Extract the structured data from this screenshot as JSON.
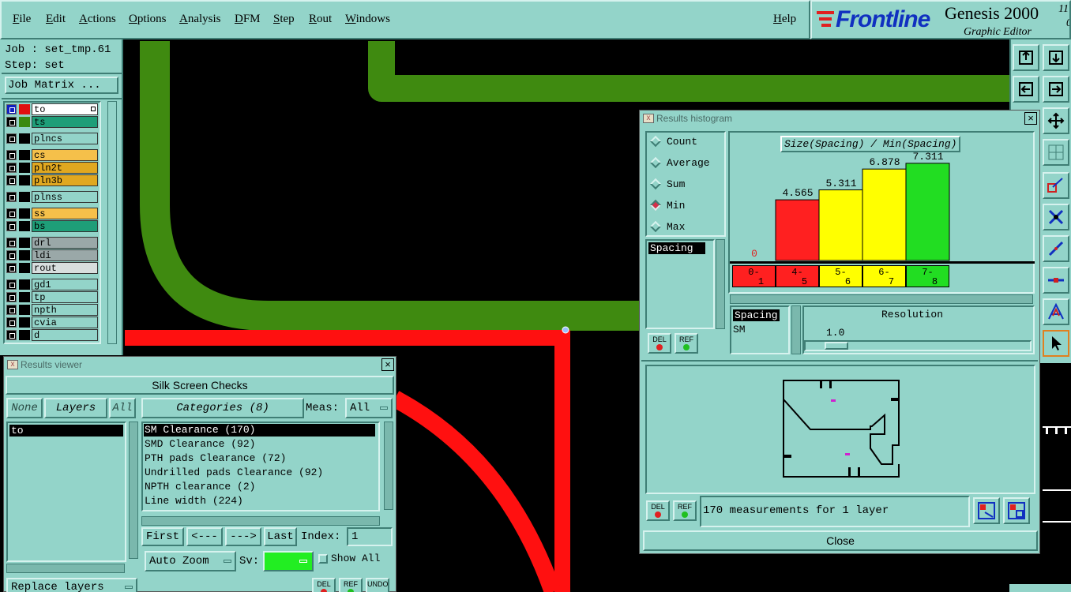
{
  "menubar": {
    "items": [
      "File",
      "Edit",
      "Actions",
      "Options",
      "Analysis",
      "DFM",
      "Step",
      "Rout",
      "Windows"
    ],
    "help": "Help"
  },
  "brand": {
    "logo": "Frontline",
    "product": "Genesis 2000",
    "subtitle": "Graphic Editor",
    "version_partial": "11",
    "extra": "0"
  },
  "job": {
    "job_label": "Job : set_tmp.61",
    "step_label": "Step: set",
    "matrix_button": "Job Matrix ..."
  },
  "layers": [
    {
      "name": "to",
      "color": "#ffffff",
      "swatch": "#e01010",
      "check": "#ffffff"
    },
    {
      "name": "ts",
      "color": "#1e9e78",
      "swatch": "#3a8a10",
      "check": "#000000"
    },
    {
      "name": "plncs",
      "color": "#93d4c9",
      "swatch": "#000000",
      "check": "#000000"
    },
    {
      "name": "cs",
      "color": "#f5c04a",
      "swatch": "#000000",
      "check": "#000000"
    },
    {
      "name": "pln2t",
      "color": "#e0a820",
      "swatch": "#000000",
      "check": "#000000"
    },
    {
      "name": "pln3b",
      "color": "#e0a820",
      "swatch": "#000000",
      "check": "#000000"
    },
    {
      "name": "plnss",
      "color": "#93d4c9",
      "swatch": "#000000",
      "check": "#000000"
    },
    {
      "name": "ss",
      "color": "#f5c04a",
      "swatch": "#000000",
      "check": "#000000"
    },
    {
      "name": "bs",
      "color": "#1e9e78",
      "swatch": "#000000",
      "check": "#000000"
    },
    {
      "name": "drl",
      "color": "#9aa8a8",
      "swatch": "#000000",
      "check": "#000000"
    },
    {
      "name": "ldi",
      "color": "#9aa8a8",
      "swatch": "#000000",
      "check": "#000000"
    },
    {
      "name": "rout",
      "color": "#d8dede",
      "swatch": "#000000",
      "check": "#000000"
    },
    {
      "name": "gd1",
      "color": "#93d4c9",
      "swatch": "#000000",
      "check": "#000000"
    },
    {
      "name": "tp",
      "color": "#93d4c9",
      "swatch": "#000000",
      "check": "#000000"
    },
    {
      "name": "npth",
      "color": "#93d4c9",
      "swatch": "#000000",
      "check": "#000000"
    },
    {
      "name": "cvia",
      "color": "#93d4c9",
      "swatch": "#000000",
      "check": "#000000"
    },
    {
      "name": "d",
      "color": "#93d4c9",
      "swatch": "#000000",
      "check": "#000000"
    }
  ],
  "results_viewer": {
    "title": "Results viewer",
    "section": "Silk Screen Checks",
    "none_btn": "None",
    "layers_btn": "Layers",
    "all_btn": "All",
    "layer_list": [
      "to"
    ],
    "categories_btn": "Categories (8)",
    "meas_label": "Meas:",
    "meas_value": "All",
    "categories": [
      "SM Clearance (170)",
      "SMD Clearance (92)",
      "PTH pads Clearance (72)",
      "Undrilled pads Clearance (92)",
      "NPTH clearance (2)",
      "Line width (224)"
    ],
    "first_btn": "First",
    "prev_btn": "<---",
    "next_btn": "--->",
    "last_btn": "Last",
    "index_label": "Index:",
    "index_value": "1",
    "auto_zoom": "Auto Zoom",
    "sv_label": "Sv:",
    "show_all": "Show All",
    "replace_layers": "Replace layers",
    "del": "DEL",
    "ref": "REF",
    "undo": "UNDO"
  },
  "histogram": {
    "title": "Results histogram",
    "modes": [
      "Count",
      "Average",
      "Sum",
      "Min",
      "Max"
    ],
    "selected_mode": "Min",
    "measure_list": [
      "Spacing"
    ],
    "chart_title": "Size(Spacing) / Min(Spacing)",
    "resolution_label": "Resolution",
    "resolution_value": "1.0",
    "sel_list": [
      "Spacing",
      "SM"
    ],
    "status": "170 measurements for 1 layer",
    "close_btn": "Close",
    "del": "DEL",
    "ref": "REF"
  },
  "chart_data": {
    "type": "bar",
    "title": "Size(Spacing) / Min(Spacing)",
    "categories": [
      "0-1",
      "4-5",
      "5-6",
      "6-7",
      "7-8"
    ],
    "category_labels": [
      [
        "0-",
        "1"
      ],
      [
        "4-",
        "5"
      ],
      [
        "5-",
        "6"
      ],
      [
        "6-",
        "7"
      ],
      [
        "7-",
        "8"
      ]
    ],
    "values": [
      0,
      4.565,
      5.311,
      6.878,
      7.311
    ],
    "value_labels": [
      "0",
      "4.565",
      "5.311",
      "6.878",
      "7.311"
    ],
    "colors": [
      "#ff2020",
      "#ff2020",
      "#ffff00",
      "#ffff00",
      "#22dd22"
    ],
    "ylim": [
      0,
      7.6
    ]
  }
}
